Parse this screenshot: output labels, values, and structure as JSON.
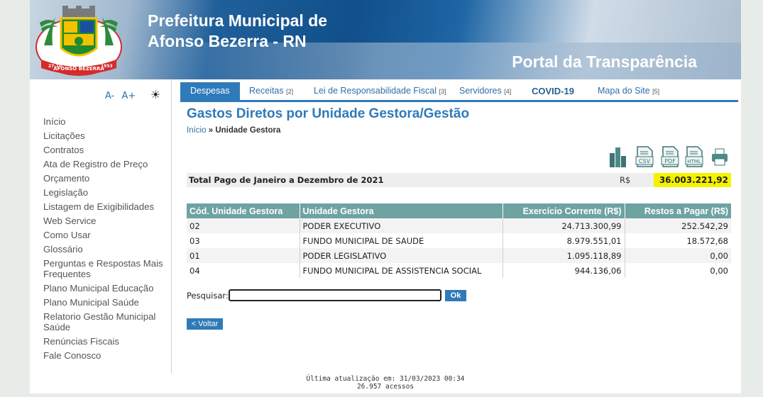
{
  "header": {
    "title_line1": "Prefeitura Municipal de",
    "title_line2": "Afonso Bezerra - RN",
    "portal": "Portal da Transparência",
    "logo_text": "AFONSO BEZERRA",
    "logo_year_left": "27-10",
    "logo_year_right": "1953"
  },
  "sidebar": {
    "font_decrease": "A-",
    "font_increase": "A+",
    "contrast_icon": "☀",
    "items": [
      "Início",
      "Licitações",
      "Contratos",
      "Ata de Registro de Preço",
      "Orçamento",
      "Legislação",
      "Listagem de Exigibilidades",
      "Web Service",
      "Como Usar",
      "Glossário",
      "Perguntas e Respostas Mais Frequentes",
      "Plano Municipal Educação",
      "Plano Municipal Saúde",
      "Relatorio Gestão Municipal Saúde",
      "Renúncias Fiscais",
      "Fale Conosco"
    ]
  },
  "tabs": [
    {
      "label": "Despesas",
      "count": ""
    },
    {
      "label": "Receitas",
      "count": "[2]"
    },
    {
      "label": "Lei de Responsabilidade Fiscal",
      "count": "[3]"
    },
    {
      "label": "Servidores",
      "count": "[4]"
    },
    {
      "label": "COVID-19",
      "count": ""
    },
    {
      "label": "Mapa do Site",
      "count": "[5]"
    }
  ],
  "main": {
    "title": "Gastos Diretos por Unidade Gestora/Gestão",
    "breadcrumb_home": "Início",
    "breadcrumb_sep": "»",
    "breadcrumb_current": "Unidade Gestora",
    "exports": {
      "csv": "CSV",
      "pdf": "PDF",
      "html": "HTML"
    },
    "total_label": "Total Pago de Janeiro a Dezembro de 2021",
    "total_currency": "R$",
    "total_value": "36.003.221,92"
  },
  "table": {
    "headers": [
      "Cód. Unidade Gestora",
      "Unidade Gestora",
      "Exercício Corrente (R$)",
      "Restos a Pagar (R$)"
    ],
    "rows": [
      [
        "02",
        "PODER EXECUTIVO",
        "24.713.300,99",
        "252.542,29"
      ],
      [
        "03",
        "FUNDO MUNICIPAL DE SAUDE",
        "8.979.551,01",
        "18.572,68"
      ],
      [
        "01",
        "PODER LEGISLATIVO",
        "1.095.118,89",
        "0,00"
      ],
      [
        "04",
        "FUNDO MUNICIPAL DE ASSISTENCIA SOCIAL",
        "944.136,06",
        "0,00"
      ]
    ]
  },
  "search": {
    "label": "Pesquisar:",
    "value": "",
    "button": "Ok"
  },
  "back_button": "< Voltar",
  "footer": {
    "updated": "Última atualização em: 31/03/2023 00:34",
    "visits": "26.957 acessos"
  },
  "colors": {
    "accent": "#2f7ab9",
    "table_header": "#6ea3a2",
    "highlight": "#f5f200"
  }
}
